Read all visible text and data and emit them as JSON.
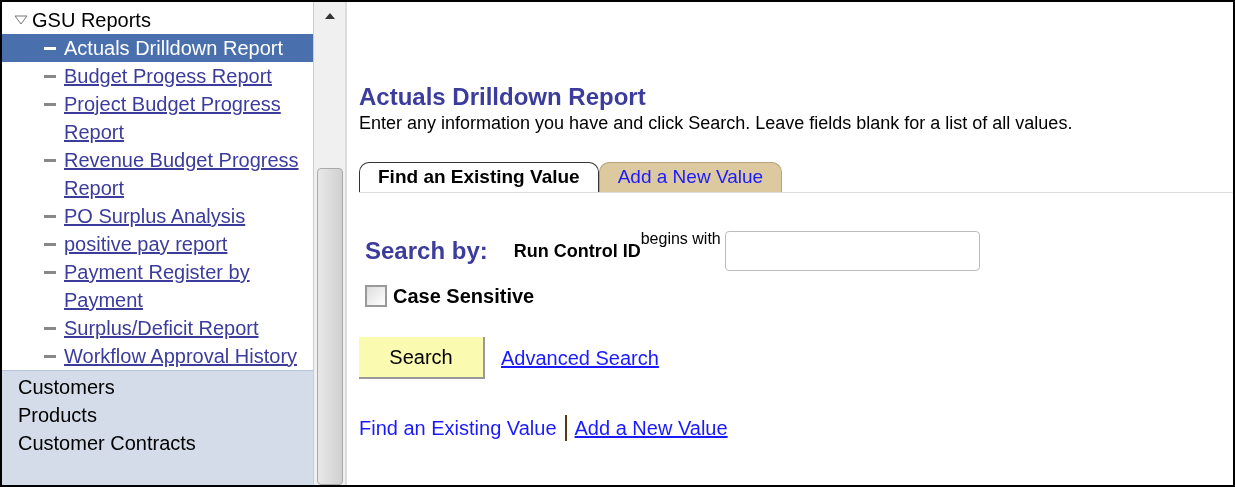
{
  "sidebar": {
    "group": {
      "label": "GSU Reports",
      "expanded": true,
      "children": [
        {
          "label": "Actuals Drilldown Report",
          "selected": true
        },
        {
          "label": "Budget Progess Report",
          "selected": false
        },
        {
          "label": "Project Budget Progress Report",
          "selected": false
        },
        {
          "label": "Revenue Budget Progress Report",
          "selected": false
        },
        {
          "label": "PO Surplus Analysis",
          "selected": false
        },
        {
          "label": "positive pay report",
          "selected": false
        },
        {
          "label": "Payment Register by Payment",
          "selected": false
        },
        {
          "label": "Surplus/Deficit Report",
          "selected": false
        },
        {
          "label": "Workflow Approval History",
          "selected": false
        }
      ]
    },
    "categories": [
      "Customers",
      "Products",
      "Customer Contracts"
    ]
  },
  "page": {
    "title": "Actuals Drilldown Report",
    "instructions": "Enter any information you have and click Search. Leave fields blank for a list of all values.",
    "tabs": [
      {
        "label": "Find an Existing Value",
        "selected": true
      },
      {
        "label": "Add a New Value",
        "selected": false
      }
    ],
    "search_by": {
      "label": "Search by:",
      "field_label": "Run Control ID",
      "operator": "begins with"
    },
    "case_sensitive": {
      "label": "Case Sensitive",
      "checked": false
    },
    "search_button": "Search",
    "advanced_search": "Advanced Search",
    "footer_links": [
      "Find an Existing Value",
      "Add a New Value"
    ]
  }
}
